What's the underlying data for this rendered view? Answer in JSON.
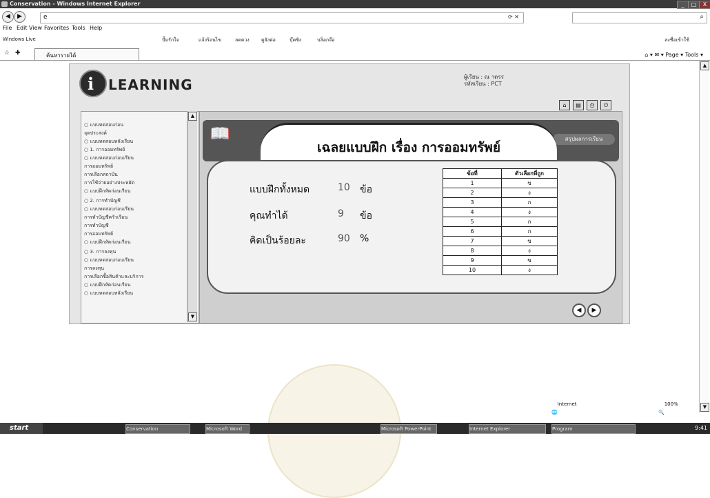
{
  "window": {
    "title": "Conservation - Windows Internet Explorer",
    "buttons": {
      "minimize": "_",
      "maximize": "□",
      "close": "X"
    }
  },
  "address_bar": {
    "value": "e",
    "right_text": "⟳ ✕"
  },
  "search": {
    "value": "",
    "placeholder": ""
  },
  "menu": [
    "File",
    "Edit",
    "View",
    "Favorites",
    "Tools",
    "Help"
  ],
  "links": {
    "windows_live": "Windows Live",
    "items": [
      "ปั๊มรักใจ",
      "แจ้งร้อนไข",
      "ลดดวง",
      "ดูยังต่อ",
      "บุ๊คซิง",
      "บล็อกจ๊อ"
    ],
    "right": "ลงชื่อเข้าใช้"
  },
  "tab": {
    "label": "ค้นหารายได้"
  },
  "command_bar": {
    "text": "⌂ ▾  ✉  ▾ Page ▾  Tools ▾"
  },
  "elearning": {
    "logo_letter": "i",
    "logo_word": "LEARNING",
    "user_line1": "ผู้เรียน : ณ าตรร",
    "user_line2": "รหัสเรียน : PCT",
    "banner_tag": "สรุปผลการเรียน",
    "title": "เฉลยแบบฝึก เรื่อง การออมทรัพย์",
    "stats": [
      {
        "label": "แบบฝึกทั้งหมด",
        "value": "10",
        "unit": "ข้อ"
      },
      {
        "label": "คุณทำได้",
        "value": "9",
        "unit": "ข้อ"
      },
      {
        "label": "คิดเป็นร้อยละ",
        "value": "90",
        "unit": "%"
      }
    ],
    "answer_table": {
      "headers": [
        "ข้อที่",
        "ตัวเลือกที่ถูก"
      ],
      "rows": [
        [
          "1",
          "ข"
        ],
        [
          "2",
          "ง"
        ],
        [
          "3",
          "ก"
        ],
        [
          "4",
          "ง"
        ],
        [
          "5",
          "ก"
        ],
        [
          "6",
          "ก"
        ],
        [
          "7",
          "ข"
        ],
        [
          "8",
          "ง"
        ],
        [
          "9",
          "ข"
        ],
        [
          "10",
          "ง"
        ]
      ]
    },
    "sidebar_items": [
      "○ แบบทดสอบก่อน",
      "  จุดประสงค์",
      "○ แบบทดสอบหลังเรียน",
      "○ 1. การออมทรัพย์",
      "  ○ แบบทดสอบก่อนเรียน",
      "  การออมทรัพย์",
      "  การเลือกสถาบัน",
      "  การใช้จ่ายอย่างประหยัด",
      "  ○ แบบฝึกหัดก่อนเรียน",
      "○ 2. การทำบัญชี",
      "  ○ แบบทดสอบก่อนเรียน",
      "  การทำบัญชีครัวเรือน",
      "  การทำบัญชี",
      "  การออมทรัพย์",
      "  ○ แบบฝึกหัดก่อนเรียน",
      "○ 3. การลงทุน",
      "  ○ แบบทดสอบก่อนเรียน",
      "  การลงทุน",
      "  การเลือกซื้อสินค้าและบริการ",
      "  ○ แบบฝึกหัดก่อนเรียน",
      "○ แบบทดสอบหลังเรียน"
    ]
  },
  "status": {
    "left": "",
    "zone": "Internet",
    "zoom": "100%"
  },
  "taskbar": {
    "start": "start",
    "tasks": [
      "Conservation",
      "Microsoft Word",
      "Microsoft PowerPoint",
      "Internet Explorer",
      "Program"
    ],
    "clock": "9:41"
  }
}
